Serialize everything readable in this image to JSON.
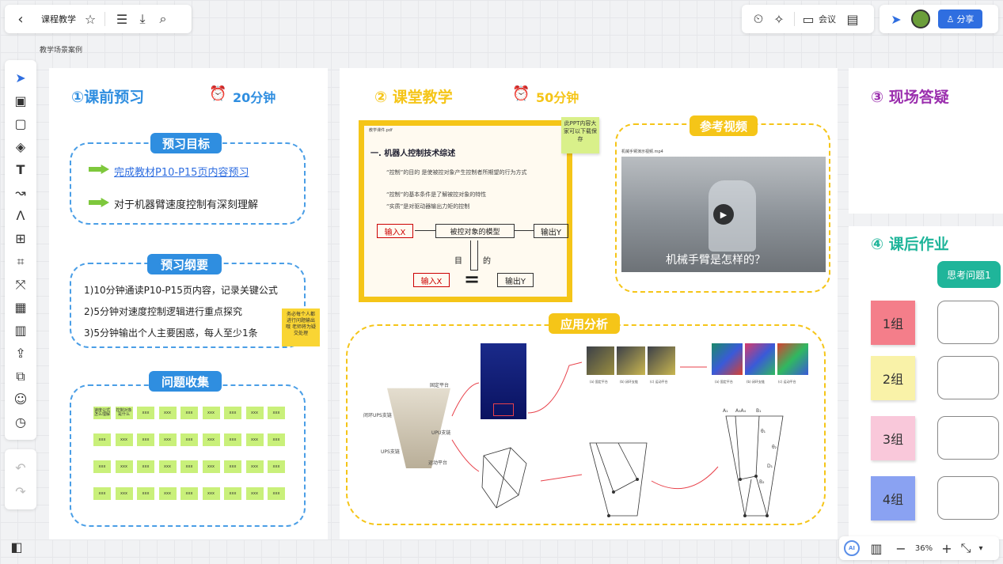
{
  "toolbar": {
    "title": "课程教学",
    "meeting_label": "会议",
    "share_label": "分享",
    "breadcrumb": "教学场景案例"
  },
  "zoom": "36%",
  "colors": {
    "blue": "#2f8ee0",
    "gold": "#f5c518",
    "purple": "#9b2fae",
    "teal": "#1fb59a",
    "red": "#e8414a"
  },
  "sections": {
    "pre": {
      "title": "①课前预习",
      "time": "20分钟"
    },
    "class": {
      "title": "② 课堂教学",
      "time": "50分钟"
    },
    "qa": {
      "title": "③ 现场答疑"
    },
    "hw": {
      "title": "④ 课后作业"
    }
  },
  "preview_goal": {
    "label": "预习目标",
    "items": [
      "完成教材P10-P15页内容预习",
      "对于机器臂速度控制有深刻理解"
    ]
  },
  "preview_outline": {
    "label": "预习纲要",
    "items": [
      "1)10分钟通读P10-P15页内容，记录关键公式",
      "2)5分钟对速度控制逻辑进行重点探究",
      "3)5分钟输出个人主要困惑，每人至少1条"
    ],
    "note": "务必每个人都进行问题输出哦 老师将为疑交处理"
  },
  "question_collect": {
    "label": "问题收集",
    "first_notes": [
      "速度公式怎么理解",
      "控制对象是什么"
    ],
    "note_text": "xxx"
  },
  "slide": {
    "header": "教学课件.pdf",
    "heading": "一. 机器人控制技术综述",
    "bullets": [
      "“控制”的目的 是使被控对象产生控制者所期望的行为方式",
      "“控制”的基本条件是了解被控对象的特性",
      "“实质”是对驱动器输出力矩的控制"
    ],
    "input_x": "输入X",
    "model": "被控对象的模型",
    "output_y": "输出Y",
    "goal_char1": "目",
    "goal_char2": "的",
    "equals": "=",
    "input_x2": "输入X",
    "output_y2": "输出Y",
    "note": "此PPT内容大家可以下载保存"
  },
  "video": {
    "label": "参考视频",
    "filename": "机械手臂演示视频.mp4",
    "subtitle": "机械手臂是怎样的？"
  },
  "analysis": {
    "label": "应用分析",
    "diagram_labels": [
      "固定平台",
      "闭环UPS支链",
      "UPU支链",
      "UPS支链",
      "运动平台"
    ],
    "captions_top1": [
      "(a) 固定平台",
      "(b) 闭环支链",
      "(c) 运动平台"
    ],
    "captions_top2": [
      "(a) 固定平台",
      "(b) 闭环支链",
      "(c) 运动平台"
    ],
    "kin_labels": [
      "A₁",
      "A₃A₄",
      "B₁",
      "D₁",
      "B₂",
      "θ₁",
      "θ₂"
    ]
  },
  "homework": {
    "question": "思考问题1",
    "groups": [
      {
        "name": "1组",
        "color": "#f47e8a"
      },
      {
        "name": "2组",
        "color": "#f9f2a8"
      },
      {
        "name": "3组",
        "color": "#f9c8da"
      },
      {
        "name": "4组",
        "color": "#8aa2f2"
      }
    ]
  }
}
